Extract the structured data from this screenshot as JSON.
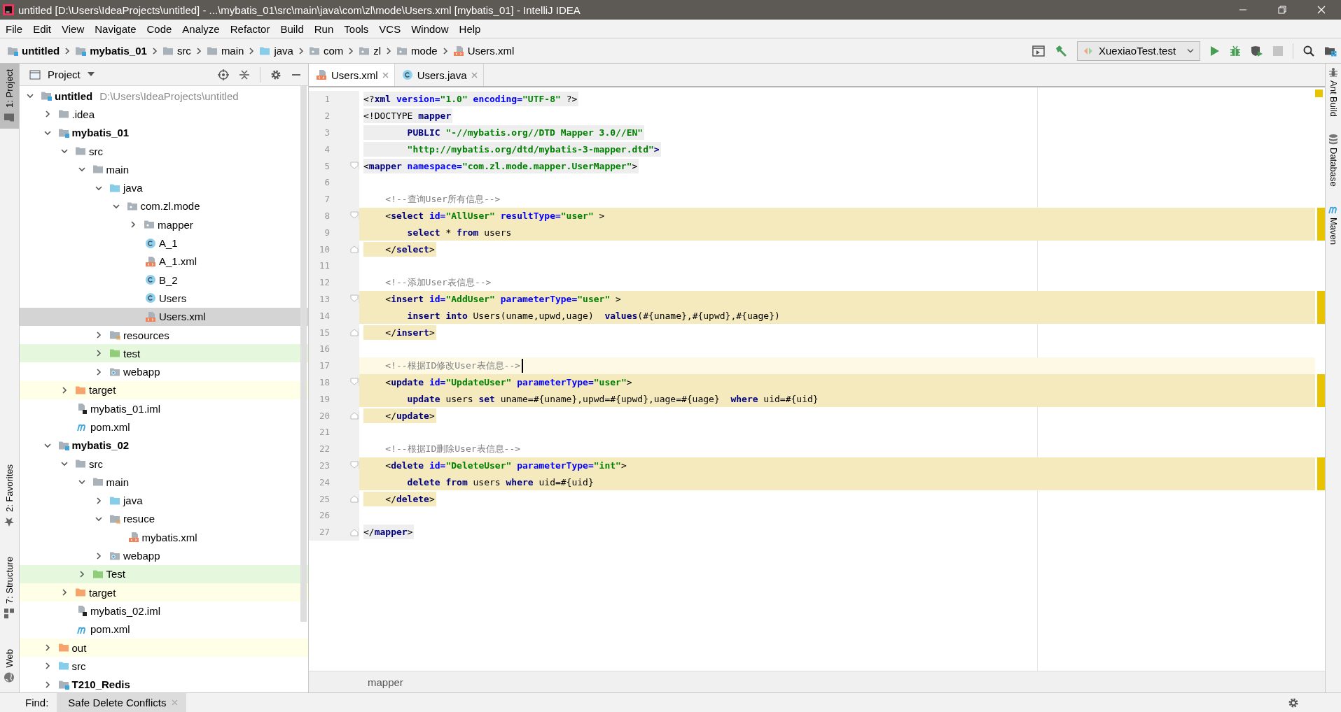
{
  "window": {
    "title": "untitled [D:\\Users\\IdeaProjects\\untitled] - ...\\mybatis_01\\src\\main\\java\\com\\zl\\mode\\Users.xml [mybatis_01] - IntelliJ IDEA"
  },
  "menu": [
    "File",
    "Edit",
    "View",
    "Navigate",
    "Code",
    "Analyze",
    "Refactor",
    "Build",
    "Run",
    "Tools",
    "VCS",
    "Window",
    "Help"
  ],
  "breadcrumbs": [
    {
      "label": "untitled",
      "kind": "module"
    },
    {
      "label": "mybatis_01",
      "kind": "module"
    },
    {
      "label": "src",
      "kind": "folder"
    },
    {
      "label": "main",
      "kind": "folder"
    },
    {
      "label": "java",
      "kind": "source"
    },
    {
      "label": "com",
      "kind": "package"
    },
    {
      "label": "zl",
      "kind": "package"
    },
    {
      "label": "mode",
      "kind": "package"
    },
    {
      "label": "Users.xml",
      "kind": "xml"
    }
  ],
  "run_configuration": {
    "label": "XuexiaoTest.test"
  },
  "left_tool_windows": {
    "top": [
      {
        "label": "1: Project",
        "kind": "project",
        "selected": true
      }
    ],
    "bottom": [
      {
        "label": "2: Favorites",
        "kind": "star",
        "selected": false
      },
      {
        "label": "7: Structure",
        "kind": "structure",
        "selected": false
      },
      {
        "label": "Web",
        "kind": "globe",
        "selected": false
      }
    ]
  },
  "right_tool_windows": [
    {
      "label": "Ant Build",
      "kind": "ant"
    },
    {
      "label": "Database",
      "kind": "database"
    },
    {
      "label": "Maven",
      "kind": "maven"
    }
  ],
  "project_panel": {
    "title": "Project",
    "tree": [
      {
        "label": "untitled",
        "kind": "module",
        "path": "D:\\Users\\IdeaProjects\\untitled",
        "selected": false,
        "expanded": true,
        "children": [
          {
            "label": ".idea",
            "kind": "folder",
            "selected": false,
            "expanded": false
          },
          {
            "label": "mybatis_01",
            "kind": "module",
            "selected": false,
            "expanded": true,
            "children": [
              {
                "label": "src",
                "kind": "folder",
                "selected": false,
                "expanded": true,
                "children": [
                  {
                    "label": "main",
                    "kind": "folder",
                    "selected": false,
                    "expanded": true,
                    "children": [
                      {
                        "label": "java",
                        "kind": "source",
                        "selected": false,
                        "expanded": true,
                        "children": [
                          {
                            "label": "com.zl.mode",
                            "kind": "package",
                            "selected": false,
                            "expanded": true,
                            "children": [
                              {
                                "label": "mapper",
                                "kind": "package",
                                "selected": false,
                                "expanded": false
                              },
                              {
                                "label": "A_1",
                                "kind": "class",
                                "selected": false
                              },
                              {
                                "label": "A_1.xml",
                                "kind": "xml",
                                "selected": false
                              },
                              {
                                "label": "B_2",
                                "kind": "class",
                                "selected": false
                              },
                              {
                                "label": "Users",
                                "kind": "class",
                                "selected": false
                              },
                              {
                                "label": "Users.xml",
                                "kind": "xml",
                                "selected": true
                              }
                            ]
                          }
                        ]
                      },
                      {
                        "label": "resources",
                        "kind": "resources",
                        "selected": false,
                        "expanded": false
                      },
                      {
                        "label": "test",
                        "kind": "test",
                        "selected": false,
                        "expanded": false
                      },
                      {
                        "label": "webapp",
                        "kind": "web",
                        "selected": false,
                        "expanded": false
                      }
                    ]
                  }
                ]
              },
              {
                "label": "target",
                "kind": "excluded",
                "selected": false,
                "expanded": false
              },
              {
                "label": "mybatis_01.iml",
                "kind": "iml",
                "selected": false
              },
              {
                "label": "pom.xml",
                "kind": "maven",
                "selected": false
              }
            ]
          },
          {
            "label": "mybatis_02",
            "kind": "module",
            "selected": false,
            "expanded": true,
            "children": [
              {
                "label": "src",
                "kind": "folder",
                "selected": false,
                "expanded": true,
                "children": [
                  {
                    "label": "main",
                    "kind": "folder",
                    "selected": false,
                    "expanded": true,
                    "children": [
                      {
                        "label": "java",
                        "kind": "source",
                        "selected": false,
                        "expanded": false
                      },
                      {
                        "label": "resuce",
                        "kind": "resources",
                        "selected": false,
                        "expanded": true,
                        "children": [
                          {
                            "label": "mybatis.xml",
                            "kind": "xml",
                            "selected": false
                          }
                        ]
                      },
                      {
                        "label": "webapp",
                        "kind": "web",
                        "selected": false,
                        "expanded": false
                      }
                    ]
                  },
                  {
                    "label": "Test",
                    "kind": "test",
                    "selected": false,
                    "expanded": false
                  }
                ]
              },
              {
                "label": "target",
                "kind": "excluded",
                "selected": false,
                "expanded": false
              },
              {
                "label": "mybatis_02.iml",
                "kind": "iml",
                "selected": false
              },
              {
                "label": "pom.xml",
                "kind": "maven",
                "selected": false
              }
            ]
          },
          {
            "label": "out",
            "kind": "excluded",
            "selected": false,
            "expanded": false
          },
          {
            "label": "src",
            "kind": "source",
            "selected": false,
            "expanded": false
          },
          {
            "label": "T210_Redis",
            "kind": "module",
            "selected": false,
            "expanded": false
          }
        ]
      }
    ]
  },
  "editor": {
    "tabs": [
      {
        "label": "Users.xml",
        "kind": "xml",
        "selected": true
      },
      {
        "label": "Users.java",
        "kind": "class",
        "selected": false
      }
    ],
    "lines": [
      {
        "number": "1",
        "kind": "tag",
        "tokens": [
          {
            "kind": "punct",
            "text": "<?"
          },
          {
            "kind": "tag",
            "text": "xml"
          },
          {
            "kind": "attr",
            "text": " version="
          },
          {
            "kind": "value",
            "text": "\"1.0\""
          },
          {
            "kind": "attr",
            "text": " encoding="
          },
          {
            "kind": "value",
            "text": "\"UTF-8\""
          },
          {
            "kind": "punct",
            "text": " ?>"
          }
        ]
      },
      {
        "number": "2",
        "kind": "tag",
        "tokens": [
          {
            "kind": "punct",
            "text": "<!DOCTYPE"
          },
          {
            "kind": "tag",
            "text": " mapper"
          }
        ]
      },
      {
        "number": "3",
        "kind": "tag",
        "tokens": [
          {
            "kind": "tag",
            "text": "        PUBLIC"
          },
          {
            "kind": "value",
            "text": " \"-//mybatis.org//DTD Mapper 3.0//EN\""
          }
        ]
      },
      {
        "number": "4",
        "kind": "tag",
        "tokens": [
          {
            "kind": "value",
            "text": "        \"http://mybatis.org/dtd/mybatis-3-mapper.dtd\""
          },
          {
            "kind": "tag",
            "text": ">"
          }
        ]
      },
      {
        "number": "5",
        "kind": "tag",
        "fold_start": true,
        "tokens": [
          {
            "kind": "punct",
            "text": "<"
          },
          {
            "kind": "tag",
            "text": "mapper"
          },
          {
            "kind": "attr",
            "text": " namespace="
          },
          {
            "kind": "value",
            "text": "\"com.zl.mode.mapper.UserMapper\""
          },
          {
            "kind": "punct",
            "text": ">"
          }
        ]
      },
      {
        "number": "6"
      },
      {
        "number": "7",
        "tokens": [
          {
            "kind": "comment",
            "text": "    <!--查询User所有信息-->"
          }
        ]
      },
      {
        "number": "8",
        "kind": "block",
        "fold_start": true,
        "tokens": [
          {
            "kind": "punct",
            "text": "    <"
          },
          {
            "kind": "tag",
            "text": "select"
          },
          {
            "kind": "attr",
            "text": " id="
          },
          {
            "kind": "value",
            "text": "\"AllUser\""
          },
          {
            "kind": "attr",
            "text": " resultType="
          },
          {
            "kind": "value",
            "text": "\"user\""
          },
          {
            "kind": "punct",
            "text": " >"
          }
        ]
      },
      {
        "number": "9",
        "kind": "block",
        "tokens": [
          {
            "kind": "keyword",
            "text": "        select"
          },
          {
            "kind": "text",
            "text": " * "
          },
          {
            "kind": "keyword",
            "text": "from"
          },
          {
            "kind": "text",
            "text": " users"
          }
        ]
      },
      {
        "number": "10",
        "kind": "block_end",
        "fold_end": true,
        "tokens": [
          {
            "kind": "punct",
            "text": "    </"
          },
          {
            "kind": "tag",
            "text": "select"
          },
          {
            "kind": "punct",
            "text": ">"
          }
        ]
      },
      {
        "number": "11"
      },
      {
        "number": "12",
        "tokens": [
          {
            "kind": "comment",
            "text": "    <!--添加User表信息-->"
          }
        ]
      },
      {
        "number": "13",
        "kind": "block",
        "fold_start": true,
        "tokens": [
          {
            "kind": "punct",
            "text": "    <"
          },
          {
            "kind": "tag",
            "text": "insert"
          },
          {
            "kind": "attr",
            "text": " id="
          },
          {
            "kind": "value",
            "text": "\"AddUser\""
          },
          {
            "kind": "attr",
            "text": " parameterType="
          },
          {
            "kind": "value",
            "text": "\"user\""
          },
          {
            "kind": "punct",
            "text": " >"
          }
        ]
      },
      {
        "number": "14",
        "kind": "block",
        "tokens": [
          {
            "kind": "keyword",
            "text": "        insert"
          },
          {
            "kind": "keyword",
            "text": " into"
          },
          {
            "kind": "text",
            "text": " Users(uname,upwd,uage)  "
          },
          {
            "kind": "keyword",
            "text": "values"
          },
          {
            "kind": "text",
            "text": "(#{uname},#{upwd},#{uage})"
          }
        ]
      },
      {
        "number": "15",
        "kind": "block_end",
        "fold_end": true,
        "tokens": [
          {
            "kind": "punct",
            "text": "    </"
          },
          {
            "kind": "tag",
            "text": "insert"
          },
          {
            "kind": "punct",
            "text": ">"
          }
        ]
      },
      {
        "number": "16"
      },
      {
        "number": "17",
        "current": true,
        "tokens": [
          {
            "kind": "comment",
            "text": "    <!--根据ID修改User表信息-->"
          }
        ]
      },
      {
        "number": "18",
        "kind": "block",
        "fold_start": true,
        "tokens": [
          {
            "kind": "punct",
            "text": "    <"
          },
          {
            "kind": "tag",
            "text": "update"
          },
          {
            "kind": "attr",
            "text": " id="
          },
          {
            "kind": "value",
            "text": "\"UpdateUser\""
          },
          {
            "kind": "attr",
            "text": " parameterType="
          },
          {
            "kind": "value",
            "text": "\"user\""
          },
          {
            "kind": "punct",
            "text": ">"
          }
        ]
      },
      {
        "number": "19",
        "kind": "block",
        "tokens": [
          {
            "kind": "keyword",
            "text": "        update"
          },
          {
            "kind": "text",
            "text": " users "
          },
          {
            "kind": "keyword",
            "text": "set"
          },
          {
            "kind": "text",
            "text": " uname=#{uname},upwd=#{upwd},uage=#{uage}  "
          },
          {
            "kind": "keyword",
            "text": "where"
          },
          {
            "kind": "text",
            "text": " uid=#{uid}"
          }
        ]
      },
      {
        "number": "20",
        "kind": "block_end",
        "fold_end": true,
        "tokens": [
          {
            "kind": "punct",
            "text": "    </"
          },
          {
            "kind": "tag",
            "text": "update"
          },
          {
            "kind": "punct",
            "text": ">"
          }
        ]
      },
      {
        "number": "21"
      },
      {
        "number": "22",
        "tokens": [
          {
            "kind": "comment",
            "text": "    <!--根据ID删除User表信息-->"
          }
        ]
      },
      {
        "number": "23",
        "kind": "block",
        "fold_start": true,
        "tokens": [
          {
            "kind": "punct",
            "text": "    <"
          },
          {
            "kind": "tag",
            "text": "delete"
          },
          {
            "kind": "attr",
            "text": " id="
          },
          {
            "kind": "value",
            "text": "\"DeleteUser\""
          },
          {
            "kind": "attr",
            "text": " parameterType="
          },
          {
            "kind": "value",
            "text": "\"int\""
          },
          {
            "kind": "punct",
            "text": ">"
          }
        ]
      },
      {
        "number": "24",
        "kind": "block",
        "tokens": [
          {
            "kind": "keyword",
            "text": "        delete"
          },
          {
            "kind": "keyword",
            "text": " from"
          },
          {
            "kind": "text",
            "text": " users "
          },
          {
            "kind": "keyword",
            "text": "where"
          },
          {
            "kind": "text",
            "text": " uid=#{uid}"
          }
        ]
      },
      {
        "number": "25",
        "kind": "block_end",
        "fold_end": true,
        "tokens": [
          {
            "kind": "punct",
            "text": "    </"
          },
          {
            "kind": "tag",
            "text": "delete"
          },
          {
            "kind": "punct",
            "text": ">"
          }
        ]
      },
      {
        "number": "26"
      },
      {
        "number": "27",
        "kind": "tag",
        "fold_end": true,
        "tokens": [
          {
            "kind": "punct",
            "text": "</"
          },
          {
            "kind": "tag",
            "text": "mapper"
          },
          {
            "kind": "punct",
            "text": ">"
          }
        ]
      }
    ],
    "breadcrumb": "mapper"
  },
  "bottom_bar": {
    "label": "Find:",
    "tabs": [
      {
        "label": "Safe Delete Conflicts",
        "selected": true
      }
    ]
  }
}
